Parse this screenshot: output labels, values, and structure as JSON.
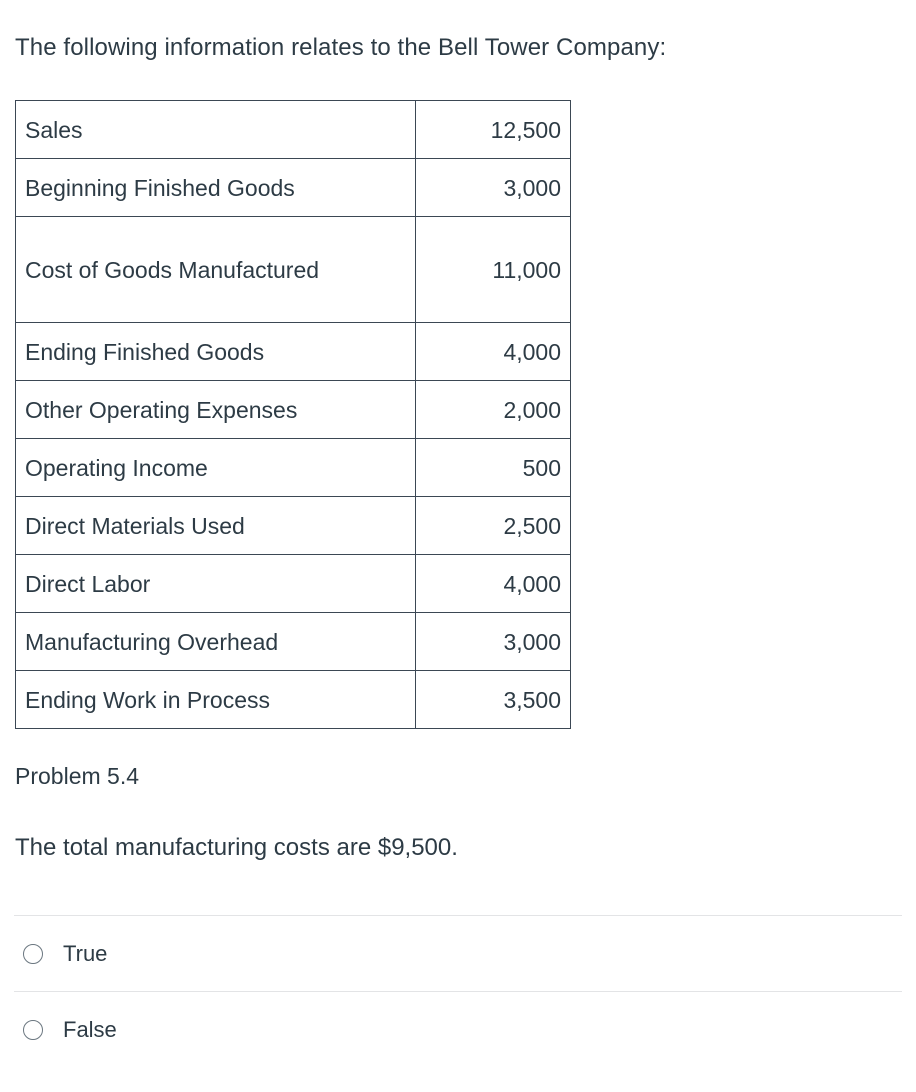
{
  "intro": {
    "text": "The following information relates to the Bell Tower Company:"
  },
  "table": {
    "rows": [
      {
        "label": "Sales",
        "value": "12,500",
        "tall": false
      },
      {
        "label": "Beginning Finished Goods",
        "value": "3,000",
        "tall": false
      },
      {
        "label": "Cost of Goods Manufactured",
        "value": "11,000",
        "tall": true
      },
      {
        "label": "Ending Finished Goods",
        "value": "4,000",
        "tall": false
      },
      {
        "label": "Other Operating Expenses",
        "value": "2,000",
        "tall": false
      },
      {
        "label": "Operating Income",
        "value": "500",
        "tall": false
      },
      {
        "label": "Direct Materials Used",
        "value": "2,500",
        "tall": false
      },
      {
        "label": "Direct Labor",
        "value": "4,000",
        "tall": false
      },
      {
        "label": "Manufacturing Overhead",
        "value": "3,000",
        "tall": false
      },
      {
        "label": "Ending Work in Process",
        "value": "3,500",
        "tall": false
      }
    ]
  },
  "problem": {
    "label": "Problem 5.4",
    "statement": "The total manufacturing costs are $9,500."
  },
  "answers": {
    "options": [
      {
        "label": "True",
        "selected": false
      },
      {
        "label": "False",
        "selected": false
      }
    ]
  },
  "colors": {
    "text": "#2d3b45",
    "table_border": "#3b4754",
    "divider": "#e3e4e6",
    "radio_border": "#6b7780",
    "background": "#ffffff"
  }
}
